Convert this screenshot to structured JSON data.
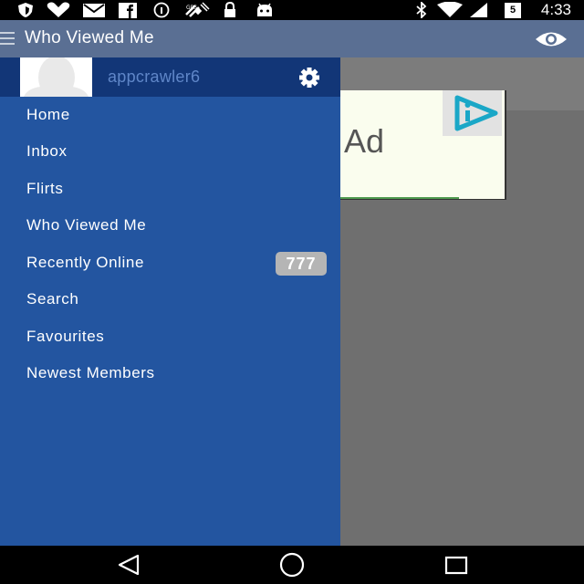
{
  "status_bar": {
    "time": "4:33",
    "battery_level": "5",
    "icons": [
      "shield-icon",
      "heart-icon",
      "mail-icon",
      "facebook-icon",
      "info-icon",
      "satellite-icon",
      "lock-icon",
      "android-icon",
      "bluetooth-icon",
      "wifi-icon",
      "signal-icon",
      "battery-icon"
    ]
  },
  "app_bar": {
    "title": "Who Viewed Me",
    "menu_icon": "menu-icon",
    "action_icon": "eye-icon"
  },
  "drawer": {
    "username": "appcrawler6",
    "settings_icon": "gear-icon",
    "items": [
      {
        "label": "Home"
      },
      {
        "label": "Inbox"
      },
      {
        "label": "Flirts"
      },
      {
        "label": "Who Viewed Me"
      },
      {
        "label": "Recently Online",
        "badge": "777"
      },
      {
        "label": "Search"
      },
      {
        "label": "Favourites"
      },
      {
        "label": "Newest Members"
      }
    ]
  },
  "ad": {
    "label": "Ad",
    "logo_icon": "ad-logo-icon"
  },
  "nav_bar": {
    "buttons": [
      "back-icon",
      "home-icon",
      "recents-icon"
    ]
  },
  "colors": {
    "app_bar": "#5a6f93",
    "drawer": "#2355a0",
    "drawer_header": "#123677",
    "username": "#5f86c8",
    "content": "#6f6f6f",
    "badge": "#b5b5b5",
    "ad_background": "#fafdee",
    "ad_logo": "#1aa7c7"
  }
}
